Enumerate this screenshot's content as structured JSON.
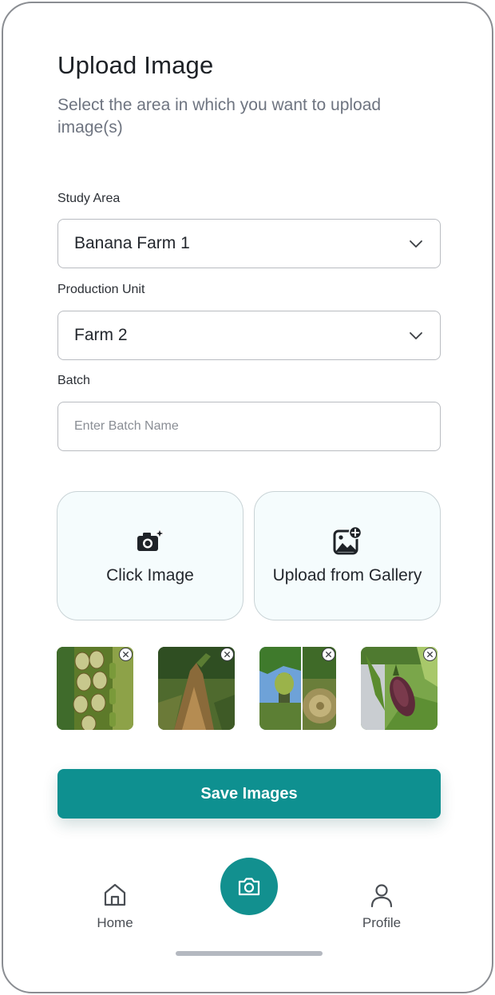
{
  "header": {
    "title": "Upload Image",
    "subtitle": "Select the area in which you want to upload image(s)"
  },
  "form": {
    "study_area": {
      "label": "Study Area",
      "value": "Banana Farm 1",
      "icon": "chevron-down-icon"
    },
    "production_unit": {
      "label": "Production Unit",
      "value": "Farm 2",
      "icon": "chevron-down-icon"
    },
    "batch": {
      "label": "Batch",
      "value": "",
      "placeholder": "Enter Batch Name"
    }
  },
  "actions": {
    "click_image": {
      "label": "Click Image",
      "icon": "camera-sparkle-icon"
    },
    "upload_gallery": {
      "label": "Upload from Gallery",
      "icon": "gallery-add-icon"
    }
  },
  "thumbnails": [
    {
      "subject": "banana bunch close-up",
      "remove_icon": "close-circle-icon"
    },
    {
      "subject": "withered banana plant",
      "remove_icon": "close-circle-icon"
    },
    {
      "subject": "banana bunch and stem cross-section",
      "remove_icon": "close-circle-icon"
    },
    {
      "subject": "banana flower",
      "remove_icon": "close-circle-icon"
    }
  ],
  "save_button": {
    "label": "Save Images"
  },
  "bottom_nav": {
    "home": {
      "label": "Home",
      "icon": "home-icon"
    },
    "camera": {
      "icon": "camera-icon"
    },
    "profile": {
      "label": "Profile",
      "icon": "user-icon"
    }
  },
  "colors": {
    "accent": "#0e9090",
    "card_background": "#f5fcfd",
    "border": "#b9bcc1"
  }
}
